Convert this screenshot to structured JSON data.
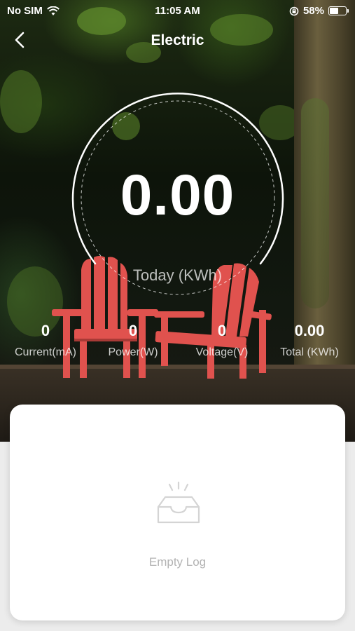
{
  "status_bar": {
    "carrier": "No SIM",
    "time": "11:05 AM",
    "battery_percent": "58%",
    "battery_level": 0.58,
    "icons": [
      "wifi-icon",
      "orientation-lock-icon",
      "battery-icon"
    ]
  },
  "nav": {
    "title": "Electric",
    "back_icon": "chevron-left-icon"
  },
  "gauge": {
    "value": "0.00",
    "label": "Today (KWh)"
  },
  "stats": [
    {
      "value": "0",
      "label": "Current(mA)"
    },
    {
      "value": "0",
      "label": "Power(W)"
    },
    {
      "value": "0",
      "label": "Voltage(V)"
    },
    {
      "value": "0.00",
      "label": "Total (KWh)"
    }
  ],
  "log": {
    "empty_text": "Empty Log",
    "empty_icon": "empty-inbox-icon"
  },
  "colors": {
    "card_background": "#ffffff",
    "empty_text": "#b3b3b3",
    "chair": "#e0524e"
  }
}
